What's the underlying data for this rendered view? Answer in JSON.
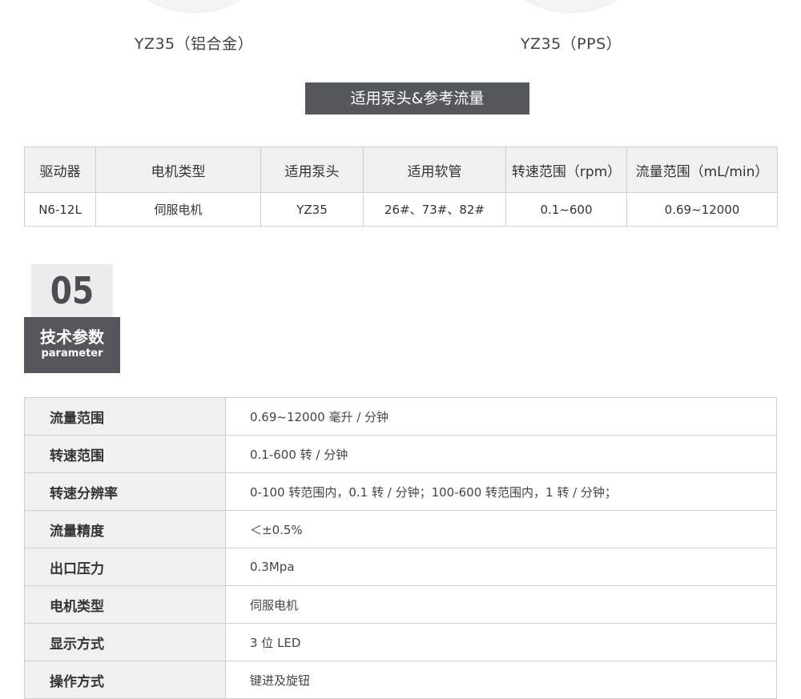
{
  "pumps": [
    {
      "caption": "YZ35（铝合金）"
    },
    {
      "caption": "YZ35（PPS）"
    }
  ],
  "section_title": "适用泵头&参考流量",
  "pump_table": {
    "headers": [
      "驱动器",
      "电机类型",
      "适用泵头",
      "适用软管",
      "转速范围（rpm）",
      "流量范围（mL/min）"
    ],
    "row": [
      "N6-12L",
      "伺服电机",
      "YZ35",
      "26#、73#、82#",
      "0.1~600",
      "0.69~12000"
    ]
  },
  "badge": {
    "number": "05",
    "title": "技术参数",
    "subtitle": "parameter"
  },
  "params": [
    {
      "key": "流量范围",
      "value": "0.69~12000 毫升 / 分钟"
    },
    {
      "key": "转速范围",
      "value": "0.1-600 转 / 分钟"
    },
    {
      "key": "转速分辨率",
      "value": "0-100 转范围内，0.1 转 / 分钟；100-600 转范围内，1 转 / 分钟；"
    },
    {
      "key": "流量精度",
      "value": "＜±0.5%"
    },
    {
      "key": "出口压力",
      "value": "0.3Mpa"
    },
    {
      "key": "电机类型",
      "value": "伺服电机"
    },
    {
      "key": "显示方式",
      "value": "3 位 LED"
    },
    {
      "key": "操作方式",
      "value": "键进及旋钮"
    }
  ]
}
